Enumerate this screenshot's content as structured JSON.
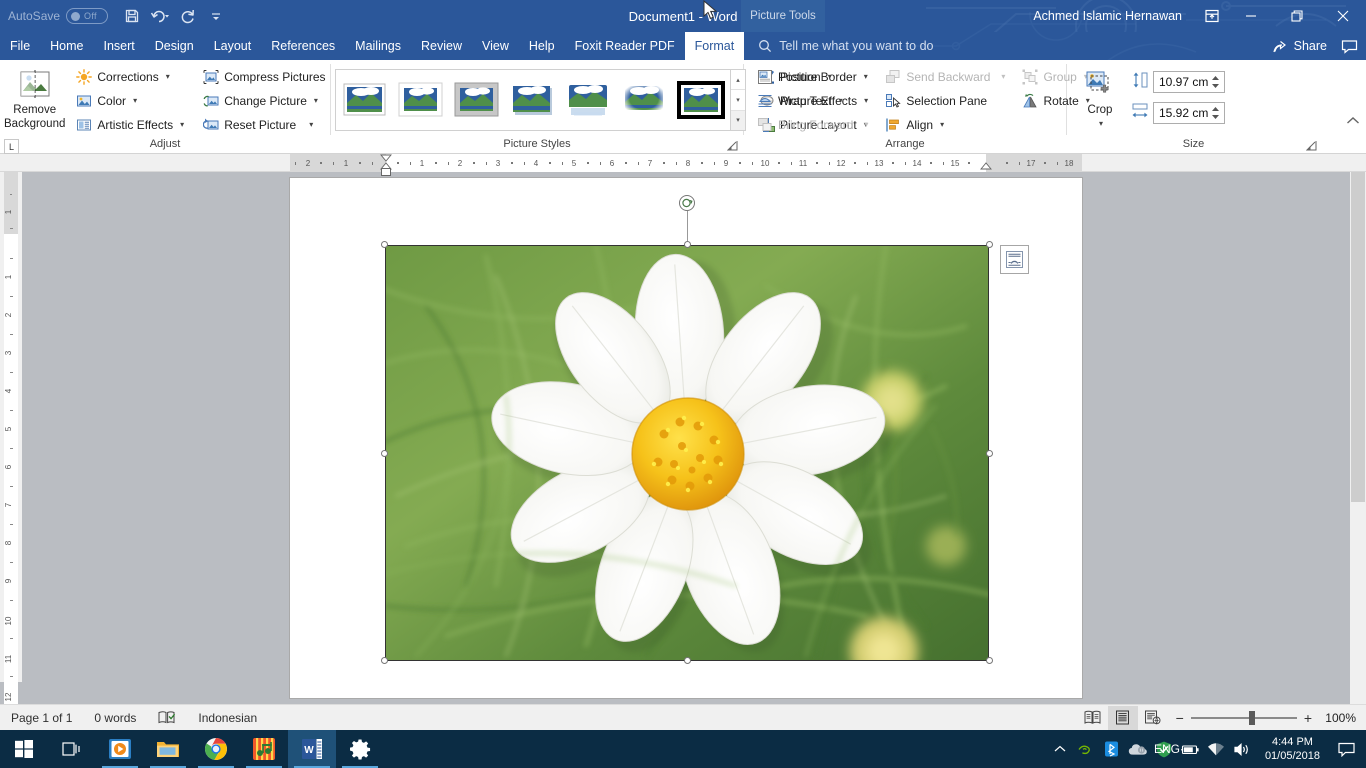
{
  "titlebar": {
    "autosave_label": "AutoSave",
    "autosave_state": "Off",
    "document_title": "Document1  -  Word",
    "contextual_tab_group": "Picture Tools",
    "account_name": "Achmed Islamic Hernawan",
    "qat": [
      {
        "name": "save-icon",
        "label": "Save"
      },
      {
        "name": "undo-icon",
        "label": "Undo"
      },
      {
        "name": "redo-icon",
        "label": "Repeat"
      },
      {
        "name": "customize-qat-icon",
        "label": "Customize Quick Access Toolbar"
      }
    ],
    "window_buttons": [
      {
        "name": "ribbon-display-options",
        "label": "Ribbon Display Options"
      },
      {
        "name": "minimize",
        "label": "Minimize"
      },
      {
        "name": "restore",
        "label": "Restore Down"
      },
      {
        "name": "close",
        "label": "Close"
      }
    ]
  },
  "tabs": [
    {
      "label": "File",
      "active": false
    },
    {
      "label": "Home",
      "active": false
    },
    {
      "label": "Insert",
      "active": false
    },
    {
      "label": "Design",
      "active": false
    },
    {
      "label": "Layout",
      "active": false
    },
    {
      "label": "References",
      "active": false
    },
    {
      "label": "Mailings",
      "active": false
    },
    {
      "label": "Review",
      "active": false
    },
    {
      "label": "View",
      "active": false
    },
    {
      "label": "Help",
      "active": false
    },
    {
      "label": "Foxit Reader PDF",
      "active": false
    },
    {
      "label": "Format",
      "active": true
    }
  ],
  "tellme": {
    "placeholder": "Tell me what you want to do",
    "icon": "search-icon"
  },
  "share": {
    "label": "Share",
    "icon": "share-icon",
    "comments_icon": "comments-icon"
  },
  "ribbon": {
    "groups": [
      {
        "label": "Adjust",
        "big_button": {
          "line1": "Remove",
          "line2": "Background",
          "icon": "remove-background-icon"
        },
        "col1": [
          {
            "label": "Corrections",
            "icon": "corrections-icon",
            "dropdown": true,
            "disabled": false
          },
          {
            "label": "Color",
            "icon": "color-icon",
            "dropdown": true,
            "disabled": false
          },
          {
            "label": "Artistic Effects",
            "icon": "artistic-effects-icon",
            "dropdown": true,
            "disabled": false
          }
        ],
        "col2": [
          {
            "label": "Compress Pictures",
            "icon": "compress-pictures-icon",
            "dropdown": false,
            "disabled": false
          },
          {
            "label": "Change Picture",
            "icon": "change-picture-icon",
            "dropdown": true,
            "disabled": false
          },
          {
            "label": "Reset Picture",
            "icon": "reset-picture-icon",
            "dropdown": true,
            "disabled": false
          }
        ]
      },
      {
        "label": "Picture Styles",
        "gallery_items": [
          {
            "name": "style-simple-frame-white",
            "selected": false
          },
          {
            "name": "style-beveled-matte-white",
            "selected": false
          },
          {
            "name": "style-metal-frame",
            "selected": false
          },
          {
            "name": "style-drop-shadow-rectangle",
            "selected": false
          },
          {
            "name": "style-reflected-rounded-rectangle",
            "selected": false
          },
          {
            "name": "style-soft-edge-rectangle",
            "selected": false
          },
          {
            "name": "style-double-frame-black",
            "selected": true
          }
        ],
        "scroll": [
          "up",
          "down",
          "more"
        ],
        "col": [
          {
            "label": "Picture Border",
            "icon": "picture-border-icon",
            "dropdown": true,
            "disabled": false
          },
          {
            "label": "Picture Effects",
            "icon": "picture-effects-icon",
            "dropdown": true,
            "disabled": false
          },
          {
            "label": "Picture Layout",
            "icon": "picture-layout-icon",
            "dropdown": true,
            "disabled": false
          }
        ]
      },
      {
        "label": "Arrange",
        "col1": [
          {
            "label": "Position",
            "icon": "position-icon",
            "dropdown": true,
            "disabled": false
          },
          {
            "label": "Wrap Text",
            "icon": "wrap-text-icon",
            "dropdown": true,
            "disabled": false
          },
          {
            "label": "Bring Forward",
            "icon": "bring-forward-icon",
            "dropdown": true,
            "disabled": true
          }
        ],
        "col2": [
          {
            "label": "Send Backward",
            "icon": "send-backward-icon",
            "dropdown": true,
            "disabled": true
          },
          {
            "label": "Selection Pane",
            "icon": "selection-pane-icon",
            "dropdown": false,
            "disabled": false
          },
          {
            "label": "Align",
            "icon": "align-icon",
            "dropdown": true,
            "disabled": false
          }
        ],
        "col3": [
          {
            "label": "Group",
            "icon": "group-icon",
            "dropdown": true,
            "disabled": true
          },
          {
            "label": "Rotate",
            "icon": "rotate-icon",
            "dropdown": true,
            "disabled": false
          }
        ]
      },
      {
        "label": "Size",
        "crop": {
          "label": "Crop",
          "icon": "crop-icon"
        },
        "height": {
          "icon": "shape-height-icon",
          "value": "10.97 cm"
        },
        "width": {
          "icon": "shape-width-icon",
          "value": "15.92 cm"
        }
      }
    ],
    "collapse_icon": "collapse-ribbon-icon"
  },
  "ruler": {
    "corner_tab_label": "L",
    "horizontal_ticks": [
      "2",
      "1",
      "1",
      "2",
      "3",
      "4",
      "5",
      "6",
      "7",
      "8",
      "9",
      "10",
      "11",
      "12",
      "13",
      "14",
      "15",
      "17",
      "18"
    ],
    "vertical_ticks": [
      "1",
      "1",
      "2",
      "3",
      "4",
      "5",
      "6",
      "7",
      "8",
      "9",
      "10",
      "11",
      "12"
    ]
  },
  "document": {
    "picture": {
      "name": "flower-photo",
      "alt": "White cosmos flower with yellow center on green foliage",
      "selected": true,
      "handles": [
        "top-left",
        "top-center",
        "top-right",
        "middle-left",
        "middle-right",
        "bottom-left",
        "bottom-center",
        "bottom-right"
      ],
      "rotate_handle": "rotate-handle"
    },
    "layout_options_button": "layout-options-button"
  },
  "statusbar": {
    "page": "Page 1 of 1",
    "words": "0 words",
    "proofing_icon": "proofing-errors-icon",
    "language": "Indonesian",
    "views": [
      {
        "name": "read-mode-view",
        "active": false
      },
      {
        "name": "print-layout-view",
        "active": true
      },
      {
        "name": "web-layout-view",
        "active": false
      }
    ],
    "zoom_out": "−",
    "zoom_in": "+",
    "zoom_level": "100%"
  },
  "taskbar": {
    "items": [
      {
        "name": "start-button",
        "label": "Start"
      },
      {
        "name": "task-view-button",
        "label": "Task View"
      },
      {
        "name": "taskbar-media-player",
        "label": "Movies & TV"
      },
      {
        "name": "taskbar-file-explorer",
        "label": "File Explorer"
      },
      {
        "name": "taskbar-chrome",
        "label": "Google Chrome"
      },
      {
        "name": "taskbar-groove-music",
        "label": "Groove Music"
      },
      {
        "name": "taskbar-word",
        "label": "Word"
      },
      {
        "name": "taskbar-settings",
        "label": "Settings"
      }
    ],
    "tray": [
      {
        "name": "show-hidden-icons-chevron"
      },
      {
        "name": "nvidia-tray-icon"
      },
      {
        "name": "bluetooth-tray-icon"
      },
      {
        "name": "onedrive-tray-icon"
      },
      {
        "name": "windows-defender-tray-icon"
      },
      {
        "name": "battery-tray-icon"
      },
      {
        "name": "wifi-tray-icon"
      },
      {
        "name": "volume-tray-icon"
      }
    ],
    "language_indicator": "ENG",
    "clock_time": "4:44 PM",
    "clock_date": "01/05/2018",
    "action_center_icon": "action-center-icon"
  },
  "colors": {
    "word_blue": "#2b579a",
    "taskbar": "#0b2c44",
    "ribbon_bg": "#ffffff",
    "status_bg": "#f0f0f0",
    "workspace_gray": "#babdc2"
  }
}
